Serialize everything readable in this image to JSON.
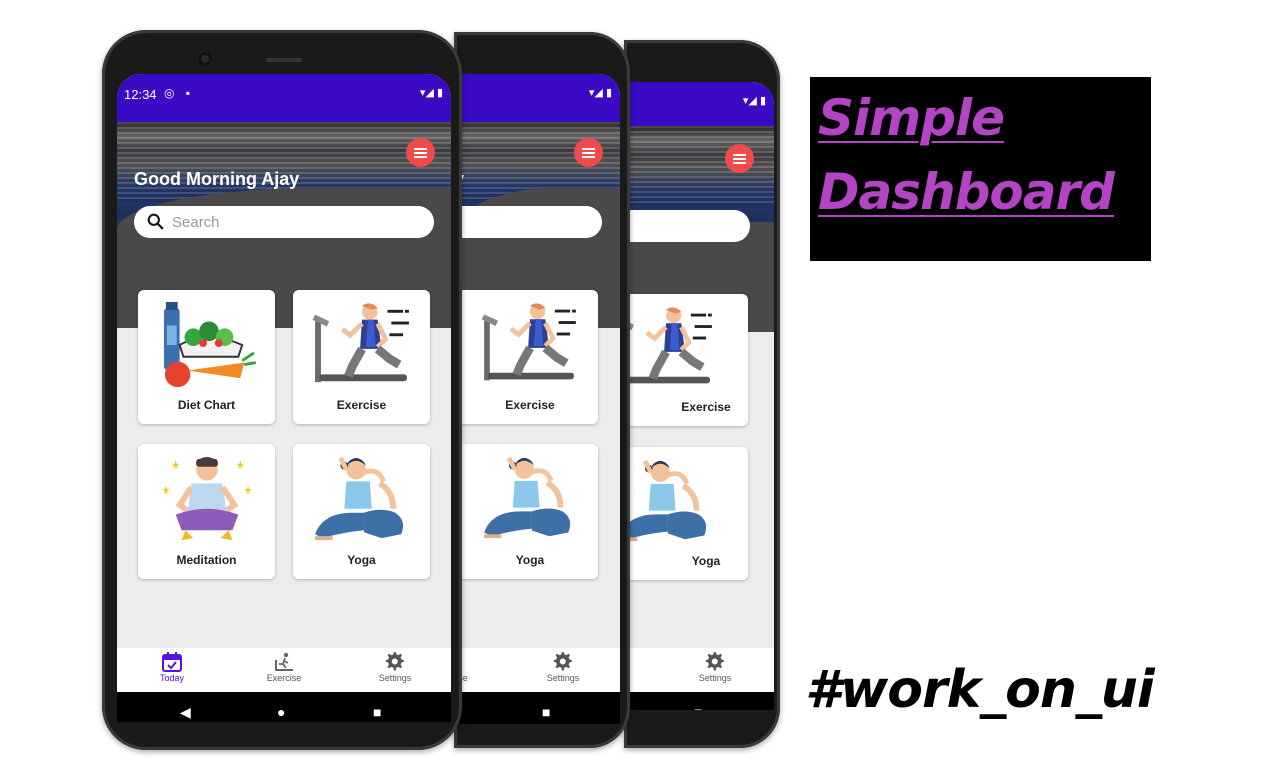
{
  "promo": {
    "title_line1": "Simple",
    "title_line2": "Dashboard",
    "hashtag": "#work_on_ui",
    "title_color": "#b344c4"
  },
  "status_bar": {
    "time": "12:34",
    "color": "#3a0ac4"
  },
  "app": {
    "greeting": "Good Morning Ajay",
    "greeting_partial": "y",
    "search_placeholder": "Search",
    "menu_icon": "hamburger-menu-icon",
    "cards": [
      {
        "label": "Diet Chart",
        "icon": "diet-chart-icon"
      },
      {
        "label": "Exercise",
        "icon": "treadmill-runner-icon"
      },
      {
        "label": "Meditation",
        "icon": "meditation-icon"
      },
      {
        "label": "Yoga",
        "icon": "yoga-pose-icon"
      }
    ],
    "bottom_nav": [
      {
        "label": "Today",
        "icon": "calendar-check-icon",
        "active": true
      },
      {
        "label": "Exercise",
        "icon": "treadmill-icon",
        "active": false
      },
      {
        "label": "Settings",
        "icon": "gear-icon",
        "active": false
      }
    ],
    "partial_nav_label": "se",
    "system_nav": [
      "back-icon",
      "home-icon",
      "recents-icon"
    ]
  }
}
